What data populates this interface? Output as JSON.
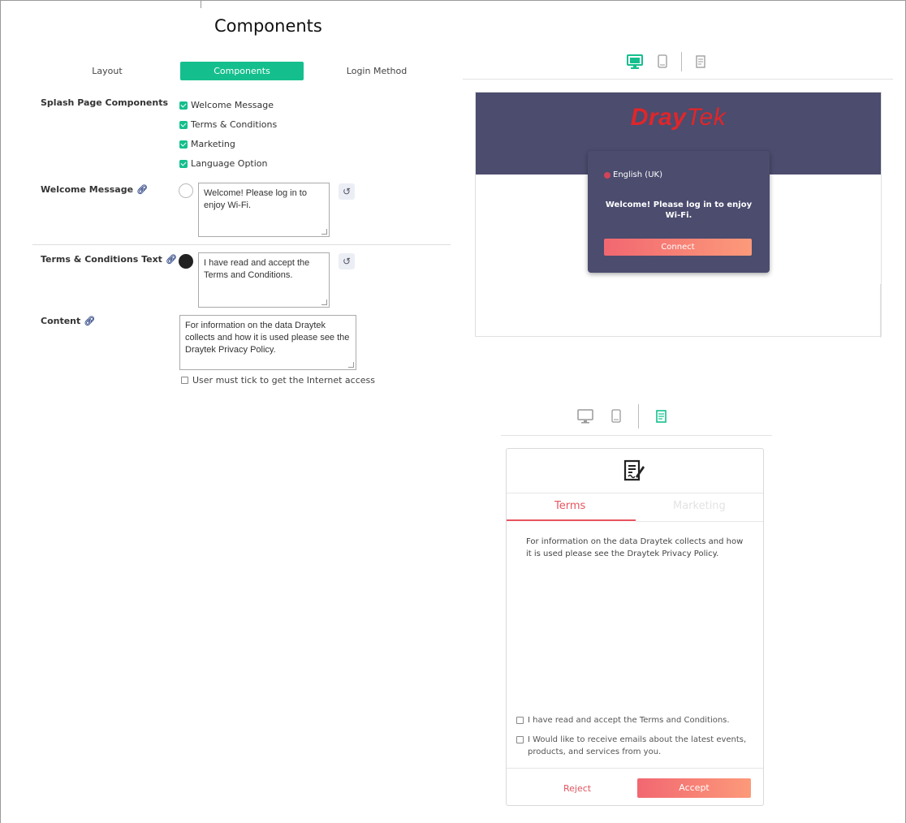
{
  "page_title": "Components",
  "tabs": [
    {
      "label": "Layout"
    },
    {
      "label": "Components"
    },
    {
      "label": "Login Method"
    }
  ],
  "active_tab": "Components",
  "accent_color": "#14bf8d",
  "splash_components": {
    "label": "Splash Page Components",
    "items": [
      {
        "label": "Welcome Message",
        "checked": true
      },
      {
        "label": "Terms & Conditions",
        "checked": true
      },
      {
        "label": "Marketing",
        "checked": true
      },
      {
        "label": "Language Option",
        "checked": true
      }
    ]
  },
  "welcome_message": {
    "label": "Welcome Message",
    "text": "Welcome! Please log in to enjoy Wi-Fi.",
    "color": "#ffffff"
  },
  "terms_text": {
    "label": "Terms & Conditions Text",
    "text": "I have read and accept the Terms and Conditions.",
    "color": "#222222"
  },
  "content": {
    "label": "Content",
    "text": "For information on the data Draytek collects and how it is used please see the Draytek Privacy Policy.",
    "tick_label": "User must tick to get the Internet access",
    "tick_checked": false
  },
  "preview_desktop": {
    "brand_left": "Dray",
    "brand_right": "Tek",
    "language": "English (UK)",
    "message": "Welcome! Please log in to enjoy Wi-Fi.",
    "connect_label": "Connect",
    "banner_color": "#4b4c6e"
  },
  "preview_terms": {
    "tab_terms": "Terms",
    "tab_marketing": "Marketing",
    "body": "For information on the data Draytek collects and how it is used please see the Draytek Privacy Policy.",
    "checkbox_terms": "I have read and accept the Terms and Conditions.",
    "checkbox_marketing": "I Would like to receive emails about the latest events, products, and services from you.",
    "reject_label": "Reject",
    "accept_label": "Accept"
  },
  "icons": [
    "link-icon",
    "reset-icon",
    "desktop-icon",
    "mobile-icon",
    "terms-doc-icon",
    "globe-icon"
  ]
}
